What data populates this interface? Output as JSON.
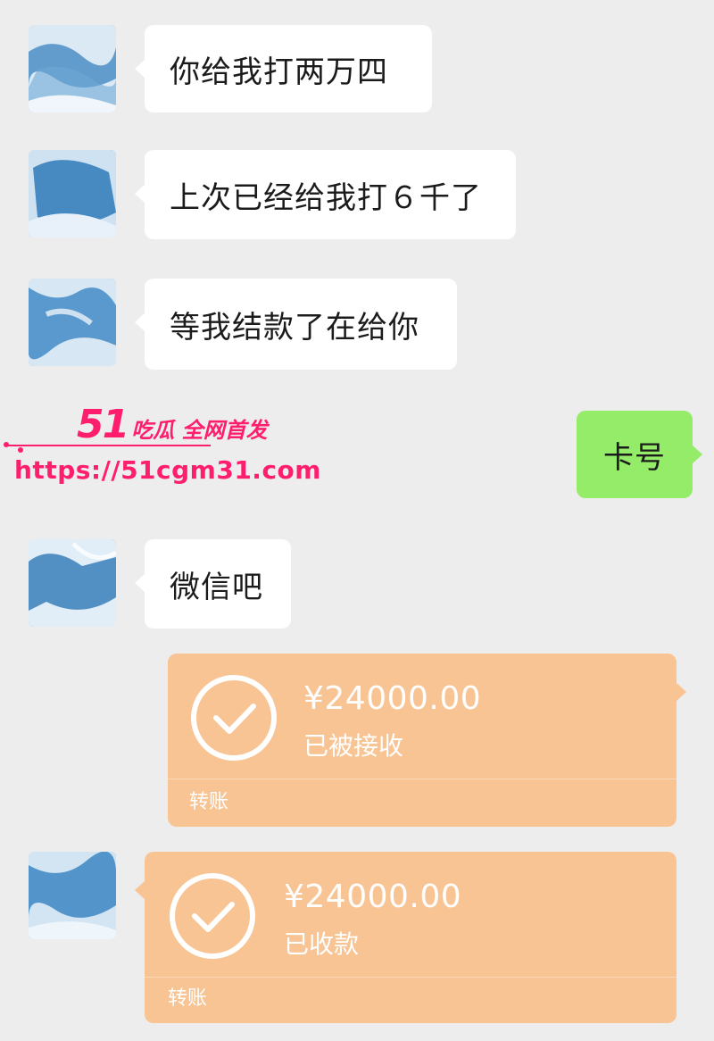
{
  "messages": [
    {
      "side": "left",
      "text": "你给我打两万四"
    },
    {
      "side": "left",
      "text": "上次已经给我打６千了"
    },
    {
      "side": "left",
      "text": "等我结款了在给你"
    },
    {
      "side": "right",
      "text": "卡号"
    },
    {
      "side": "left",
      "text": "微信吧"
    }
  ],
  "transfers": [
    {
      "side": "right",
      "amount": "¥24000.00",
      "status": "已被接收",
      "kind": "转账"
    },
    {
      "side": "left",
      "amount": "¥24000.00",
      "status": "已收款",
      "kind": "转账"
    }
  ],
  "watermark": {
    "brand_num": "51",
    "brand_text": "吃瓜 全网首发",
    "url": "https://51cgm31.com"
  },
  "colors": {
    "background": "#ededed",
    "incoming_bubble": "#ffffff",
    "outgoing_bubble": "#95ec69",
    "transfer_card": "#f8c493",
    "watermark": "#ff1d6e"
  },
  "icons": {
    "transfer_status": "check-circle-icon",
    "avatar": "avatar-image"
  }
}
